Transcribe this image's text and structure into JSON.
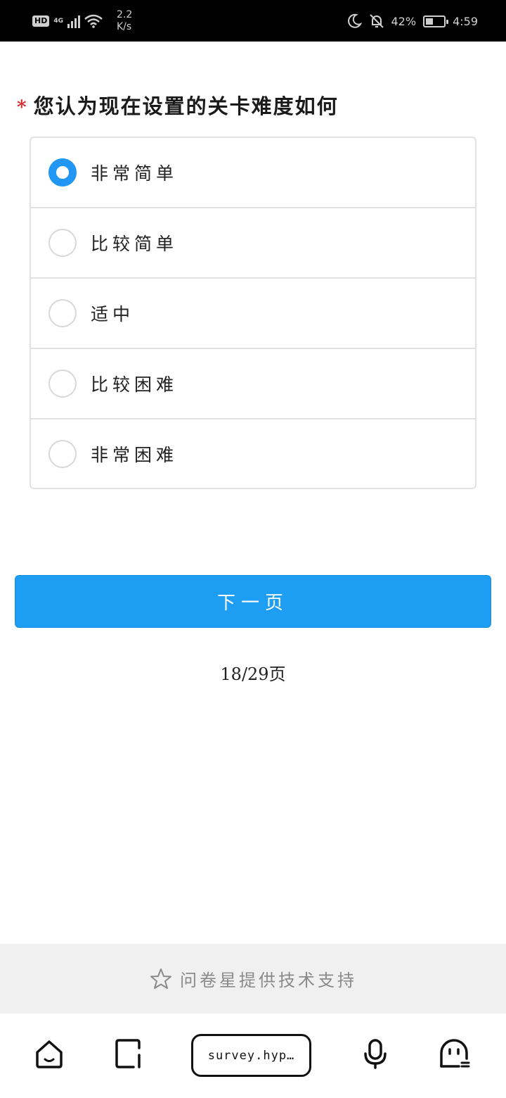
{
  "status_bar": {
    "hd": "HD",
    "network": "4G",
    "speed_value": "2.2",
    "speed_unit": "K/s",
    "battery_percent": "42%",
    "battery_level": 0.42,
    "time": "4:59"
  },
  "question": {
    "required_mark": "*",
    "title": "您认为现在设置的关卡难度如何"
  },
  "options": [
    {
      "label": "非常简单",
      "checked": true
    },
    {
      "label": "比较简单",
      "checked": false
    },
    {
      "label": "适中",
      "checked": false
    },
    {
      "label": "比较困难",
      "checked": false
    },
    {
      "label": "非常困难",
      "checked": false
    }
  ],
  "next_button": {
    "label": "下一页"
  },
  "pager": {
    "text": "18/29页"
  },
  "footer": {
    "text": "问卷星提供技术支持",
    "icon": "star-outline-icon"
  },
  "browser_nav": {
    "url": "survey.hyp…",
    "icons": [
      "home-icon",
      "tabs-icon",
      "microphone-icon",
      "assistant-icon"
    ]
  },
  "colors": {
    "accent": "#1e9ef3",
    "required": "#d9262c",
    "border": "#e1e1e1"
  }
}
